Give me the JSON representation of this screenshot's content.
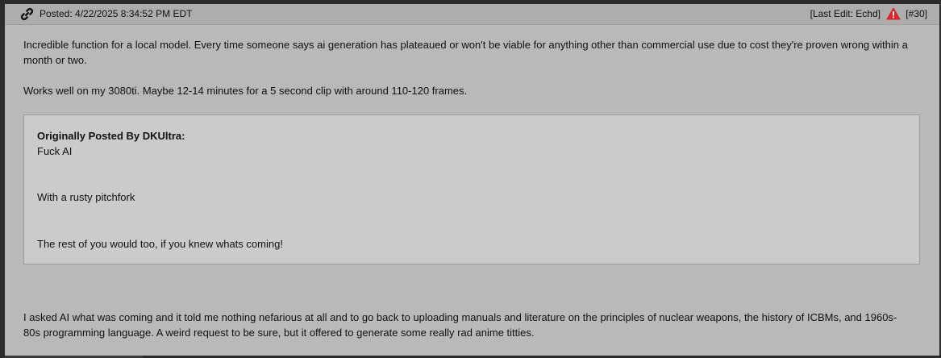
{
  "header": {
    "link_icon": "link-icon",
    "posted": "Posted: 4/22/2025 8:34:52 PM EDT",
    "last_edit": "[Last Edit: Echd]",
    "warning_icon": "warning-triangle-icon",
    "warning_color": "#d9262c",
    "post_number": "[#30]"
  },
  "body": {
    "paragraph_1": "Incredible function for a local model. Every time someone says ai generation has plateaued or won't be viable for anything other than commercial use due to cost they're proven wrong within a month or two.",
    "paragraph_2": "Works well on my 3080ti. Maybe 12-14 minutes for a 5 second clip with around 110-120 frames.",
    "quote": {
      "author": "Originally Posted By DKUltra:",
      "line_1": "Fuck AI",
      "line_2": "With a rusty pitchfork",
      "line_3": "The rest of you would too, if you knew whats coming!"
    },
    "paragraph_3": "I asked AI what was coming and it told me nothing nefarious at all and to go back to uploading manuals and literature on the principles of nuclear weapons, the history of ICBMs, and 1960s-80s programming language. A weird request to be sure, but it offered to generate some really rad anime titties."
  },
  "colors": {
    "post_background": "#b9b9b9",
    "header_background": "#adadad",
    "quote_background": "#cbcbcb"
  }
}
